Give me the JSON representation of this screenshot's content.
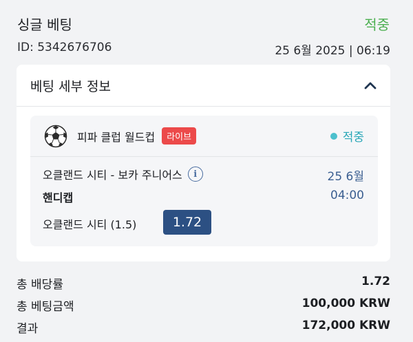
{
  "header": {
    "title": "싱글 베팅",
    "status": "적중",
    "id_text": "ID: 5342676706",
    "datetime": "25 6월 2025 | 06:19"
  },
  "details": {
    "title": "베팅 세부 정보",
    "toggle_icon": "chevron-up-icon",
    "bet": {
      "sport_icon": "soccer-ball-icon",
      "league": "피파 클럽 월드컵",
      "live_label": "라이브",
      "status": "적중",
      "match": "오클랜드 시티 - 보카 주니어스",
      "info_icon_glyph": "i",
      "date": "25 6월",
      "market": "핸디캡",
      "time": "04:00",
      "selection": "오클랜드 시티 (1.5)",
      "odds": "1.72"
    }
  },
  "summary": [
    {
      "label": "총 배당률",
      "value": "1.72"
    },
    {
      "label": "총 베팅금액",
      "value": "100,000 KRW"
    },
    {
      "label": "결과",
      "value": "172,000 KRW"
    }
  ],
  "colors": {
    "win_green": "#4caf50",
    "status_teal": "#29a7b7",
    "live_red": "#ec4a4a",
    "odds_blue": "#2c5083"
  }
}
